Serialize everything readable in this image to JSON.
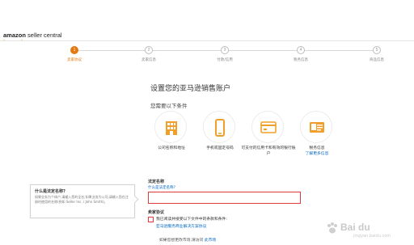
{
  "header": {
    "logo_brand": "amazon",
    "logo_product": "seller central",
    "accent_color": "#e47911"
  },
  "stepper": {
    "active_index": 0,
    "steps": [
      {
        "number": "1",
        "label": "卖家协议"
      },
      {
        "number": "2",
        "label": "卖家信息"
      },
      {
        "number": "3",
        "label": "付款/信用"
      },
      {
        "number": "4",
        "label": "税务信息"
      },
      {
        "number": "5",
        "label": "商品信息"
      }
    ]
  },
  "main": {
    "title": "设置您的亚马逊销售账户",
    "subtitle": "您需要以下条件",
    "requirements": [
      {
        "icon": "building-icon",
        "label": "公司名称和地址"
      },
      {
        "icon": "mobile-phone-icon",
        "label": "手机或固定号码"
      },
      {
        "icon": "credit-card-icon",
        "label": "可支付的信用卡和有效的银行账户"
      },
      {
        "icon": "id-card-icon",
        "label": "税务信息",
        "more": "了解更多信息"
      }
    ]
  },
  "info_box": {
    "title": "什么是法定名称?",
    "text": "如果业务为个体户,请输入您的全名;如果业务为公司,请输入您在注册时使用的名称(例如 Seller Inc. / John Smith)。"
  },
  "form": {
    "legal_name_label": "法定名称",
    "legal_name_hint": "什么是法定名称?",
    "legal_name_value": "",
    "agreement_label": "卖家协议",
    "agreement_text": "我已阅读并接受以下文件中的条款和条件:",
    "agreement_link": "亚马逊服务商业解决方案协议",
    "agreement_checked": false,
    "change_prefix": "如果您想更改市场,请访问",
    "change_link": "此市场"
  },
  "watermark": {
    "brand": "Bai du",
    "sub": "jingyan.baidu.com"
  }
}
